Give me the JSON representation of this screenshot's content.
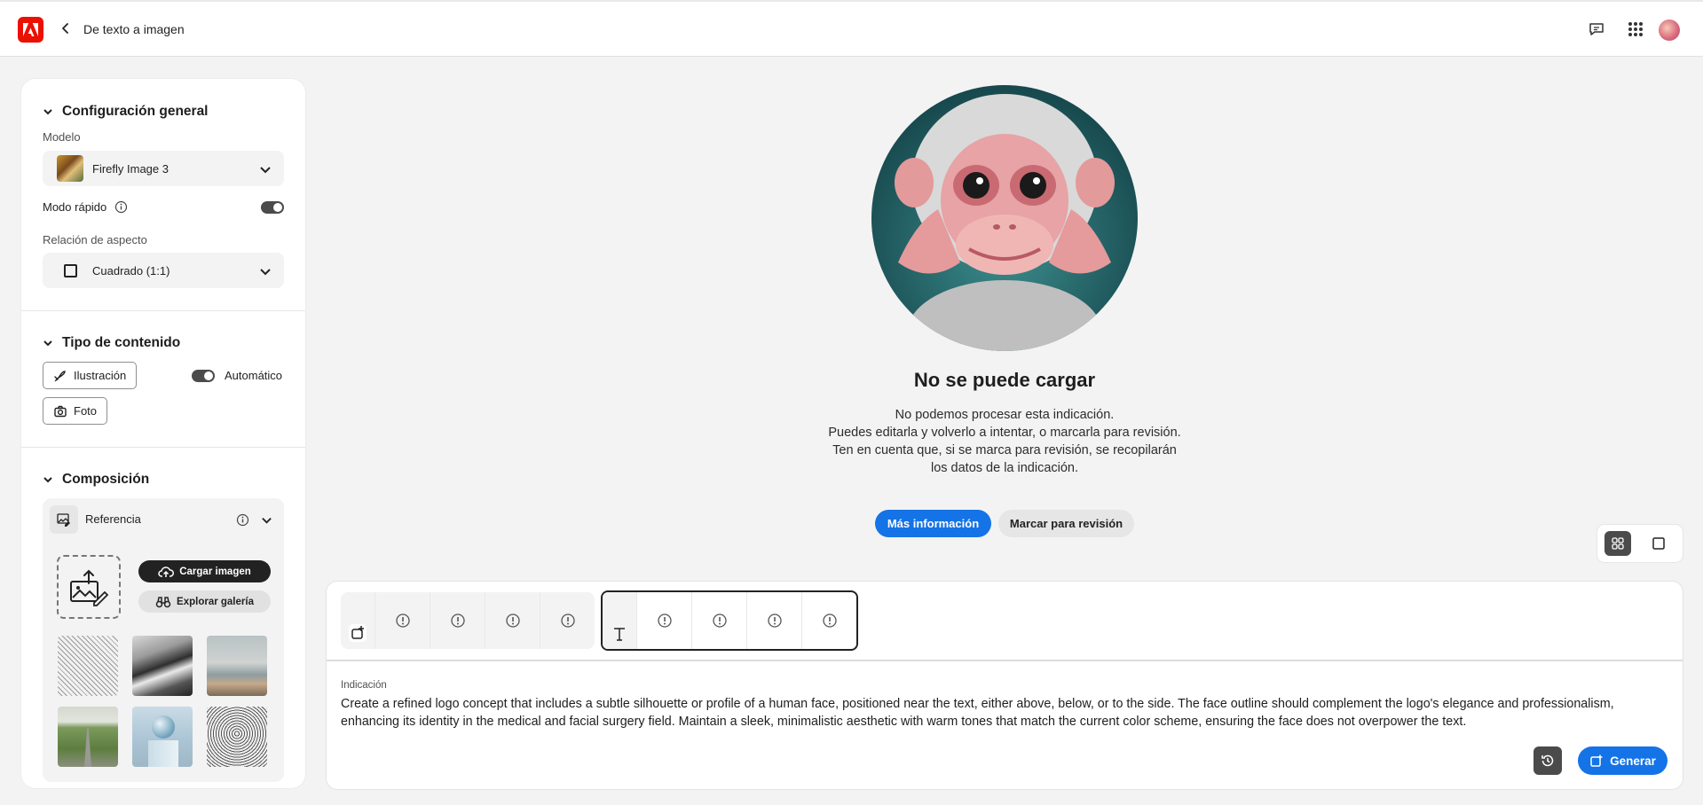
{
  "header": {
    "title": "De texto a imagen"
  },
  "general": {
    "title": "Configuración general",
    "model_label": "Modelo",
    "model_value": "Firefly Image 3",
    "fast_mode_label": "Modo rápido",
    "fast_mode_on": true,
    "aspect_label": "Relación de aspecto",
    "aspect_value": "Cuadrado (1:1)"
  },
  "content_type": {
    "title": "Tipo de contenido",
    "illustration_label": "Ilustración",
    "photo_label": "Foto",
    "auto_label": "Automático",
    "auto_on": true
  },
  "composition": {
    "title": "Composición",
    "reference_label": "Referencia",
    "upload_label": "Cargar imagen",
    "gallery_label": "Explorar galería"
  },
  "error": {
    "title": "No se puede cargar",
    "line1": "No podemos procesar esta indicación.",
    "line2": "Puedes editarla y volverlo a intentar, o marcarla para revisión.",
    "line3": "Ten en cuenta que, si se marca para revisión, se recopilarán los datos de la indicación.",
    "more_info": "Más información",
    "flag_review": "Marcar para revisión"
  },
  "prompt": {
    "label": "Indicación",
    "text": "Create a refined logo concept that includes a subtle silhouette or profile of a human face, positioned near the text, either above, below, or to the side. The face outline should complement the logo's elegance and professionalism, enhancing its identity in the medical and facial surgery field. Maintain a sleek, minimalistic aesthetic with warm tones that match the current color scheme, ensuring the face does not overpower the text.",
    "generate": "Generar"
  },
  "colors": {
    "accent": "#1473e6",
    "brand": "#eb1000",
    "dark": "#4b4b4b"
  }
}
